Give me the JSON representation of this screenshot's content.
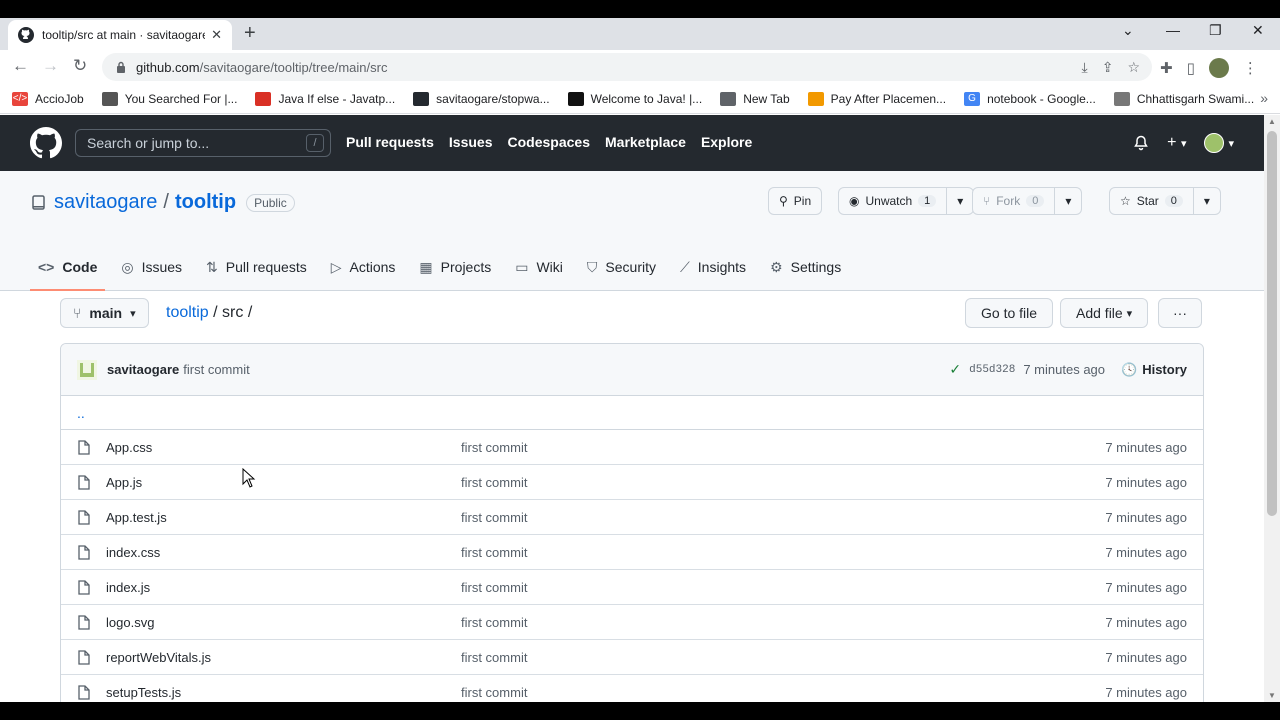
{
  "browser": {
    "tab_title": "tooltip/src at main · savitaogare/",
    "close_glyph": "✕",
    "newtab_glyph": "+",
    "url_host": "github.com",
    "url_path": "/savitaogare/tooltip/tree/main/src",
    "bookmarks": [
      {
        "label": "AccioJob",
        "icon_color": "#e8453c",
        "glyph": "</>"
      },
      {
        "label": "You Searched For |...",
        "icon_color": "#555555",
        "glyph": ""
      },
      {
        "label": "Java If else - Javatp...",
        "icon_color": "#d93025",
        "glyph": ""
      },
      {
        "label": "savitaogare/stopwa...",
        "icon_color": "#24292f",
        "glyph": ""
      },
      {
        "label": "Welcome to Java! |...",
        "icon_color": "#111111",
        "glyph": ""
      },
      {
        "label": "New Tab",
        "icon_color": "#5f6368",
        "glyph": ""
      },
      {
        "label": "Pay After Placemen...",
        "icon_color": "#f29900",
        "glyph": ""
      },
      {
        "label": "notebook - Google...",
        "icon_color": "#4285f4",
        "glyph": "G"
      },
      {
        "label": "Chhattisgarh Swami...",
        "icon_color": "#777777",
        "glyph": ""
      }
    ]
  },
  "github": {
    "search_placeholder": "Search or jump to...",
    "search_key": "/",
    "nav": [
      "Pull requests",
      "Issues",
      "Codespaces",
      "Marketplace",
      "Explore"
    ],
    "bell_glyph": "🔔",
    "plus_glyph": "+",
    "caret_glyph": "▾"
  },
  "repo": {
    "owner": "savitaogare",
    "separator": "/",
    "name": "tooltip",
    "visibility": "Public",
    "pin_label": "Pin",
    "unwatch_label": "Unwatch",
    "unwatch_count": "1",
    "fork_label": "Fork",
    "fork_count": "0",
    "star_label": "Star",
    "star_count": "0",
    "tabs": [
      {
        "label": "Code",
        "icon": "<>",
        "active": true
      },
      {
        "label": "Issues",
        "icon": "◎",
        "active": false
      },
      {
        "label": "Pull requests",
        "icon": "⇅",
        "active": false
      },
      {
        "label": "Actions",
        "icon": "▷",
        "active": false
      },
      {
        "label": "Projects",
        "icon": "▦",
        "active": false
      },
      {
        "label": "Wiki",
        "icon": "▭",
        "active": false
      },
      {
        "label": "Security",
        "icon": "⛉",
        "active": false
      },
      {
        "label": "Insights",
        "icon": "⟋",
        "active": false
      },
      {
        "label": "Settings",
        "icon": "⚙",
        "active": false
      }
    ]
  },
  "files": {
    "branch": "main",
    "crumb_root": "tooltip",
    "crumb_rest": "/ src /",
    "go_to_file": "Go to file",
    "add_file": "Add file",
    "more_glyph": "···",
    "commit": {
      "author": "savitaogare",
      "message": "first commit",
      "check_glyph": "✓",
      "sha": "d55d328",
      "age": "7 minutes ago",
      "history_label": "History"
    },
    "parent_dir": "..",
    "rows": [
      {
        "name": "App.css",
        "message": "first commit",
        "age": "7 minutes ago"
      },
      {
        "name": "App.js",
        "message": "first commit",
        "age": "7 minutes ago"
      },
      {
        "name": "App.test.js",
        "message": "first commit",
        "age": "7 minutes ago"
      },
      {
        "name": "index.css",
        "message": "first commit",
        "age": "7 minutes ago"
      },
      {
        "name": "index.js",
        "message": "first commit",
        "age": "7 minutes ago"
      },
      {
        "name": "logo.svg",
        "message": "first commit",
        "age": "7 minutes ago"
      },
      {
        "name": "reportWebVitals.js",
        "message": "first commit",
        "age": "7 minutes ago"
      },
      {
        "name": "setupTests.js",
        "message": "first commit",
        "age": "7 minutes ago"
      }
    ]
  }
}
